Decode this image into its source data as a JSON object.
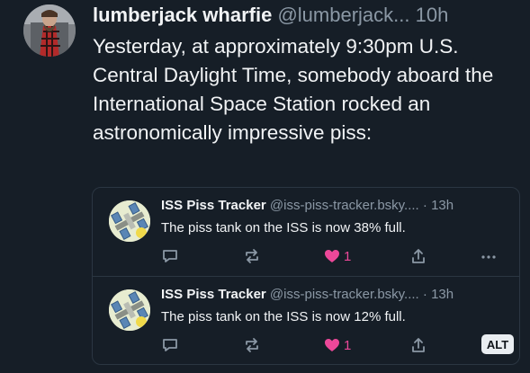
{
  "post": {
    "display_name": "lumberjack wharfie",
    "handle": "@lumberjack...",
    "time": "10h",
    "text": "Yesterday, at approximately 9:30pm U.S. Central Daylight Time, somebody aboard the International Space Station rocked an astronomically impressive piss:"
  },
  "quotes": [
    {
      "name": "ISS Piss Tracker",
      "handle": "@iss-piss-tracker.bsky....",
      "time": "· 13h",
      "text": "The piss tank on the ISS is now 38% full.",
      "likes": "1"
    },
    {
      "name": "ISS Piss Tracker",
      "handle": "@iss-piss-tracker.bsky....",
      "time": "· 13h",
      "text": "The piss tank on the ISS is now 12% full.",
      "likes": "1",
      "alt_label": "ALT"
    }
  ],
  "colors": {
    "background": "#161e27",
    "muted": "#8b98a5",
    "like": "#ec4899"
  }
}
